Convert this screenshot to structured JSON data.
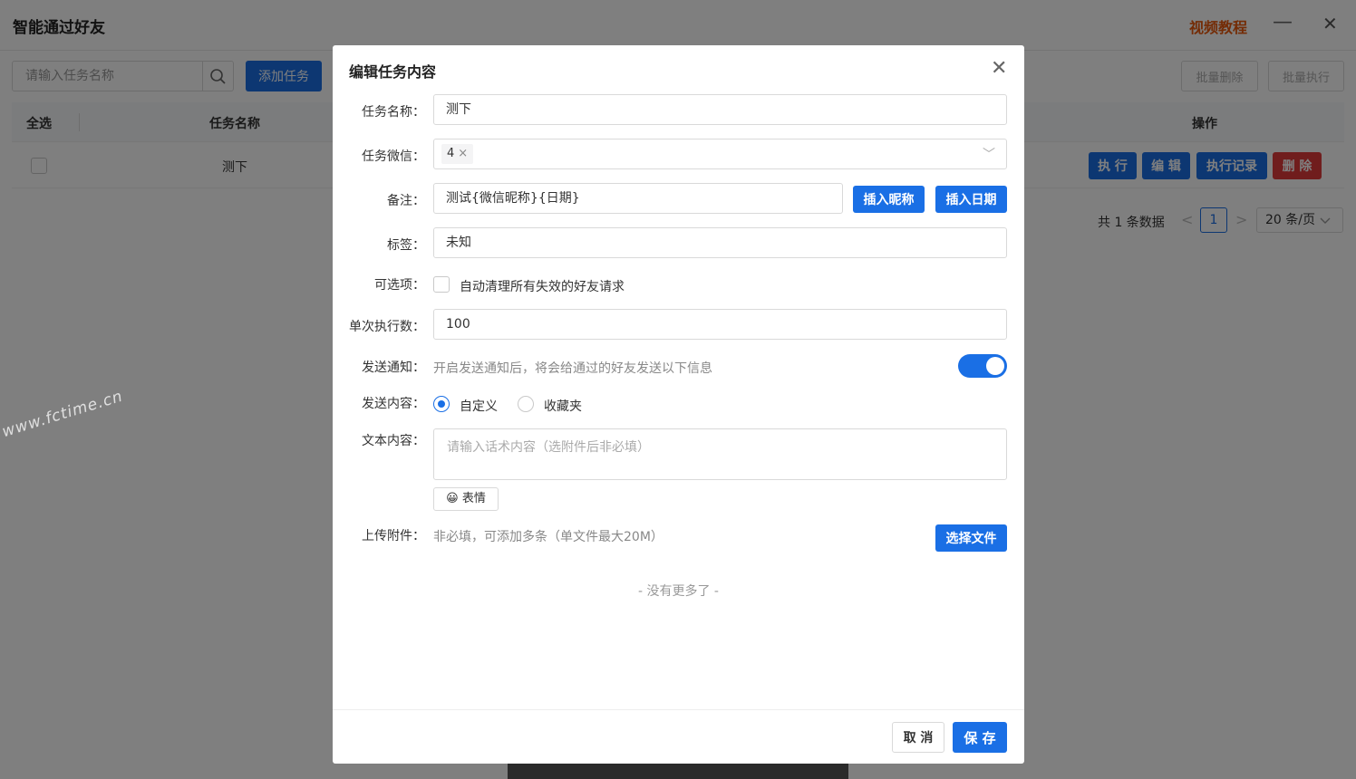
{
  "app": {
    "title": "智能通过好友",
    "video_link": "视频教程",
    "minimize_glyph": "—",
    "close_glyph": "✕"
  },
  "toolbar": {
    "search_placeholder": "请输入任务名称",
    "add_task_label": "添加任务",
    "batch_delete_label": "批量删除",
    "batch_execute_label": "批量执行"
  },
  "table": {
    "headers": {
      "select_all": "全选",
      "task_name": "任务名称",
      "actions": "操作"
    },
    "rows": [
      {
        "name": "测下",
        "actions": {
          "execute": "执 行",
          "edit": "编 辑",
          "history": "执行记录",
          "delete": "删 除"
        }
      }
    ]
  },
  "pagination": {
    "total": "共 1 条数据",
    "current_page": "1",
    "page_size": "20 条/页",
    "prev_glyph": "<",
    "next_glyph": ">"
  },
  "watermark": "www.fctime.cn",
  "modal": {
    "title": "编辑任务内容",
    "close_glyph": "✕",
    "fields": {
      "task_name": {
        "label": "任务名称：",
        "value": "测下"
      },
      "task_wechat": {
        "label": "任务微信：",
        "tag": "4",
        "tag_close": "×",
        "arrow": "﹀"
      },
      "remark": {
        "label": "备注：",
        "value": "测试{微信昵称}{日期}",
        "insert_nickname": "插入昵称",
        "insert_date": "插入日期"
      },
      "tag": {
        "label": "标签：",
        "value": "未知"
      },
      "options": {
        "label": "可选项：",
        "checkbox_text": "自动清理所有失效的好友请求",
        "checked": false
      },
      "batch_count": {
        "label": "单次执行数：",
        "value": "100"
      },
      "notify": {
        "label": "发送通知：",
        "hint": "开启发送通知后，将会给通过的好友发送以下信息",
        "enabled": true
      },
      "send_content": {
        "label": "发送内容：",
        "option_custom": "自定义",
        "option_favorites": "收藏夹",
        "selected": "自定义"
      },
      "text_content": {
        "label": "文本内容：",
        "placeholder": "请输入话术内容（选附件后非必填）",
        "emoji_button": "表情",
        "emoji_glyph": "😀"
      },
      "attachment": {
        "label": "上传附件：",
        "hint": "非必填，可添加多条（单文件最大20M）",
        "choose_button": "选择文件"
      }
    },
    "no_more": "- 没有更多了 -",
    "cancel_label": "取 消",
    "save_label": "保 存"
  },
  "colors": {
    "primary": "#1a6fe5",
    "danger": "#e03a3a",
    "video_link": "#e8590c",
    "overlay": "rgba(0,0,0,0.5)"
  }
}
